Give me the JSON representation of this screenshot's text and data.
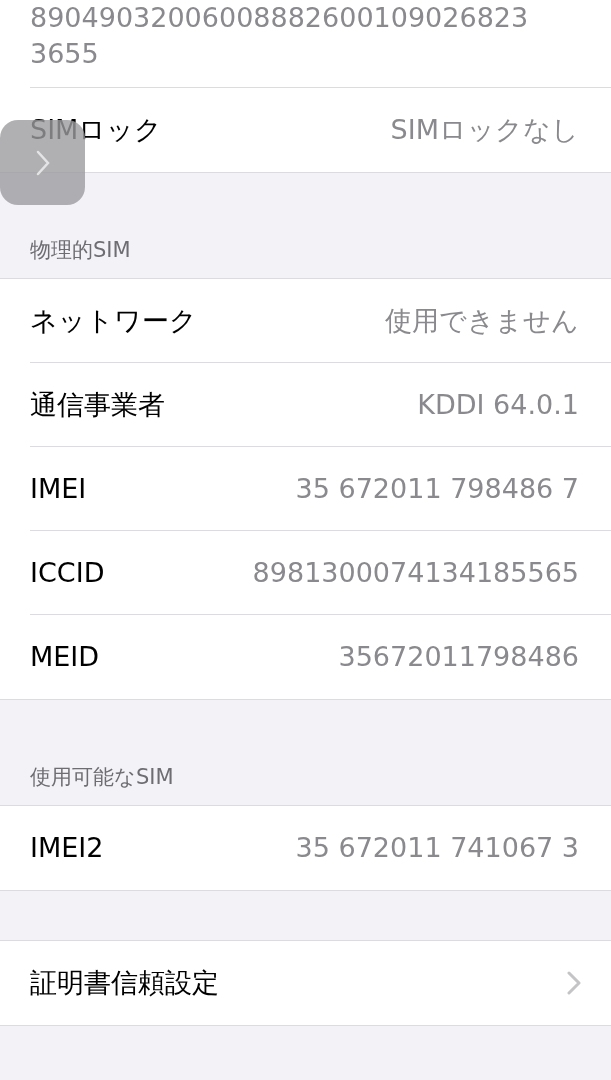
{
  "top_value": {
    "lines": [
      "89049032006008882600109026823",
      "3655"
    ]
  },
  "sections": [
    {
      "kind": "plain",
      "rows": [
        {
          "label": "SIMロック",
          "value": "SIMロックなし",
          "kind": "info"
        }
      ]
    },
    {
      "kind": "headed",
      "header": "物理的SIM",
      "rows": [
        {
          "label": "ネットワーク",
          "value": "使用できません",
          "kind": "info"
        },
        {
          "label": "通信事業者",
          "value": "KDDI 64.0.1",
          "kind": "info"
        },
        {
          "label": "IMEI",
          "value": "35 672011 798486 7",
          "kind": "info"
        },
        {
          "label": "ICCID",
          "value": "8981300074134185565",
          "kind": "info"
        },
        {
          "label": "MEID",
          "value": "35672011798486",
          "kind": "info"
        }
      ]
    },
    {
      "kind": "headed",
      "header": "使用可能なSIM",
      "rows": [
        {
          "label": "IMEI2",
          "value": "35 672011 741067 3",
          "kind": "info"
        }
      ]
    },
    {
      "kind": "spacer",
      "rows": [
        {
          "label": "証明書信頼設定",
          "kind": "link"
        }
      ]
    }
  ]
}
